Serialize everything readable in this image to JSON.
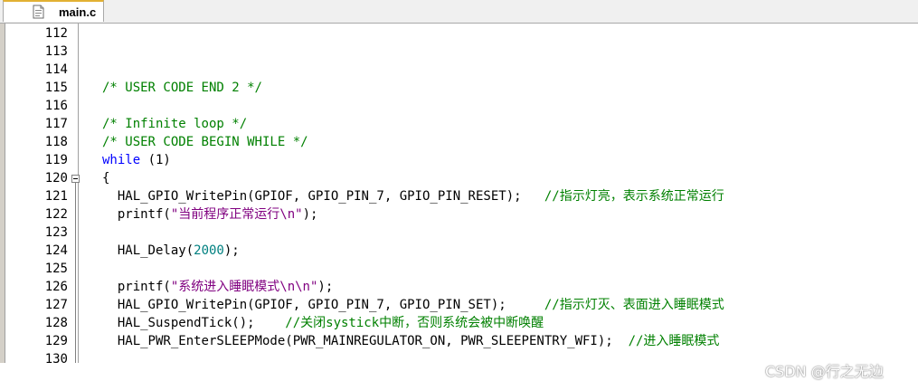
{
  "tab": {
    "label": "main.c"
  },
  "lines": [
    {
      "num": "112",
      "tokens": []
    },
    {
      "num": "113",
      "tokens": []
    },
    {
      "num": "114",
      "tokens": []
    },
    {
      "num": "115",
      "tokens": [
        {
          "t": "  /* USER CODE END 2 */",
          "c": "comment"
        }
      ]
    },
    {
      "num": "116",
      "tokens": []
    },
    {
      "num": "117",
      "tokens": [
        {
          "t": "  /* Infinite loop */",
          "c": "comment"
        }
      ]
    },
    {
      "num": "118",
      "tokens": [
        {
          "t": "  /* USER CODE BEGIN WHILE */",
          "c": "comment"
        }
      ]
    },
    {
      "num": "119",
      "tokens": [
        {
          "t": "  ",
          "c": ""
        },
        {
          "t": "while",
          "c": "keyword"
        },
        {
          "t": " (1)",
          "c": ""
        }
      ]
    },
    {
      "num": "120",
      "tokens": [
        {
          "t": "  {",
          "c": ""
        }
      ]
    },
    {
      "num": "121",
      "tokens": [
        {
          "t": "    HAL_GPIO_WritePin(GPIOF, GPIO_PIN_7, GPIO_PIN_RESET);   ",
          "c": ""
        },
        {
          "t": "//指示灯亮，表示系统正常运行",
          "c": "comment"
        }
      ]
    },
    {
      "num": "122",
      "tokens": [
        {
          "t": "    printf(",
          "c": ""
        },
        {
          "t": "\"当前程序正常运行\\n\"",
          "c": "string"
        },
        {
          "t": ");",
          "c": ""
        }
      ]
    },
    {
      "num": "123",
      "tokens": []
    },
    {
      "num": "124",
      "tokens": [
        {
          "t": "    HAL_Delay(",
          "c": ""
        },
        {
          "t": "2000",
          "c": "number"
        },
        {
          "t": ");",
          "c": ""
        }
      ]
    },
    {
      "num": "125",
      "tokens": []
    },
    {
      "num": "126",
      "tokens": [
        {
          "t": "    printf(",
          "c": ""
        },
        {
          "t": "\"系统进入睡眠模式\\n\\n\"",
          "c": "string"
        },
        {
          "t": ");",
          "c": ""
        }
      ]
    },
    {
      "num": "127",
      "tokens": [
        {
          "t": "    HAL_GPIO_WritePin(GPIOF, GPIO_PIN_7, GPIO_PIN_SET);     ",
          "c": ""
        },
        {
          "t": "//指示灯灭、表面进入睡眠模式",
          "c": "comment"
        }
      ]
    },
    {
      "num": "128",
      "tokens": [
        {
          "t": "    HAL_SuspendTick();    ",
          "c": ""
        },
        {
          "t": "//关闭systick中断，否则系统会被中断唤醒",
          "c": "comment"
        }
      ]
    },
    {
      "num": "129",
      "tokens": [
        {
          "t": "    HAL_PWR_EnterSLEEPMode(PWR_MAINREGULATOR_ON, PWR_SLEEPENTRY_WFI);  ",
          "c": ""
        },
        {
          "t": "//进入睡眠模式",
          "c": "comment"
        }
      ]
    },
    {
      "num": "130",
      "tokens": []
    }
  ],
  "fold": {
    "line": "120",
    "state": "expanded"
  },
  "watermark": "CSDN @行之无边",
  "colors": {
    "comment": "#008000",
    "keyword": "#0000ff",
    "number": "#008080",
    "string": "#800080",
    "tab_accent": "#e2b133"
  }
}
